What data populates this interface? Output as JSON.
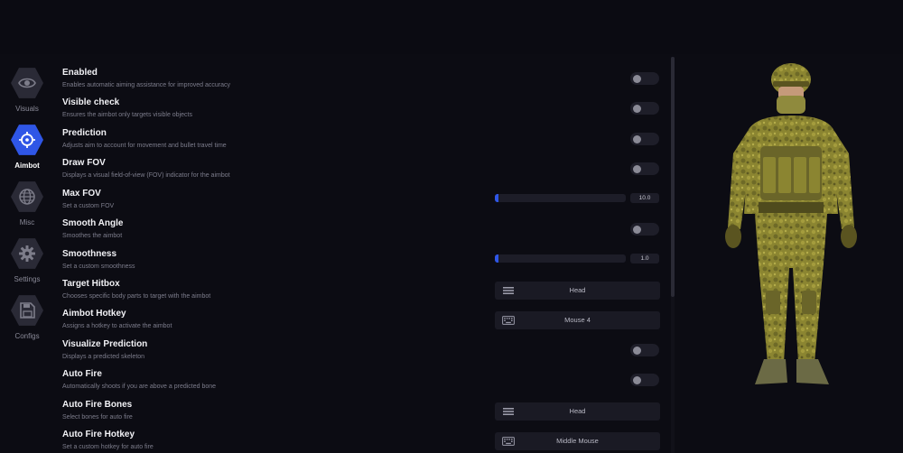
{
  "sidebar": {
    "items": [
      {
        "label": "Visuals",
        "icon": "eye-icon",
        "active": false
      },
      {
        "label": "Aimbot",
        "icon": "crosshair-icon",
        "active": true
      },
      {
        "label": "Misc",
        "icon": "globe-icon",
        "active": false
      },
      {
        "label": "Settings",
        "icon": "gear-icon",
        "active": false
      },
      {
        "label": "Configs",
        "icon": "save-icon",
        "active": false
      }
    ]
  },
  "colors": {
    "accent": "#2f56e6",
    "background": "#0c0c13"
  },
  "settings": [
    {
      "title": "Enabled",
      "desc": "Enables automatic aiming assistance for improved accuracy",
      "control": "toggle",
      "on": false
    },
    {
      "title": "Visible check",
      "desc": "Ensures the aimbot only targets visible objects",
      "control": "toggle",
      "on": false
    },
    {
      "title": "Prediction",
      "desc": "Adjusts aim to account for movement and bullet travel time",
      "control": "toggle",
      "on": false
    },
    {
      "title": "Draw FOV",
      "desc": "Displays a visual field-of-view (FOV) indicator for the aimbot",
      "control": "toggle",
      "on": false
    },
    {
      "title": "Max FOV",
      "desc": "Set a custom FOV",
      "control": "slider",
      "value": "10.0",
      "fill_fraction": 0.03
    },
    {
      "title": "Smooth Angle",
      "desc": "Smoothes the aimbot",
      "control": "toggle",
      "on": false
    },
    {
      "title": "Smoothness",
      "desc": "Set a custom smoothness",
      "control": "slider",
      "value": "1.0",
      "fill_fraction": 0.03
    },
    {
      "title": "Target Hitbox",
      "desc": "Chooses specific body parts to target with the aimbot",
      "control": "select",
      "value": "Head",
      "icon": "list-icon"
    },
    {
      "title": "Aimbot Hotkey",
      "desc": "Assigns a hotkey to activate the aimbot",
      "control": "select",
      "value": "Mouse 4",
      "icon": "keyboard-icon"
    },
    {
      "title": "Visualize Prediction",
      "desc": "Displays a predicted skeleton",
      "control": "toggle",
      "on": false
    },
    {
      "title": "Auto Fire",
      "desc": "Automatically shoots if you are above a predicted bone",
      "control": "toggle",
      "on": false
    },
    {
      "title": "Auto Fire Bones",
      "desc": "Select bones for auto fire",
      "control": "select",
      "value": "Head",
      "icon": "list-icon"
    },
    {
      "title": "Auto Fire Hotkey",
      "desc": "Set a custom hotkey for auto fire",
      "control": "select",
      "value": "Middle Mouse",
      "icon": "keyboard-icon"
    }
  ]
}
